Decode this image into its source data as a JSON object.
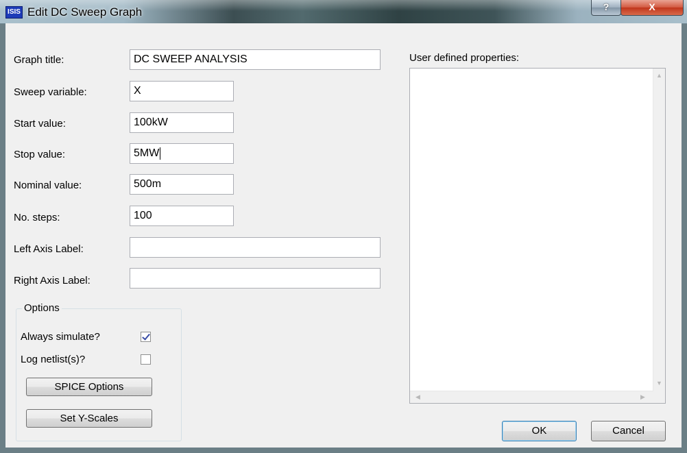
{
  "window": {
    "title": "Edit DC Sweep Graph",
    "app_icon_text": "ISIS",
    "help_glyph": "?",
    "close_glyph": "X"
  },
  "form": {
    "graph_title": {
      "label": "Graph title:",
      "value": "DC SWEEP ANALYSIS"
    },
    "sweep_variable": {
      "label": "Sweep variable:",
      "value": "X"
    },
    "start_value": {
      "label": "Start value:",
      "value": "100kW"
    },
    "stop_value": {
      "label": "Stop value:",
      "value": "5MW"
    },
    "nominal_value": {
      "label": "Nominal value:",
      "value": "500m"
    },
    "no_steps": {
      "label": "No. steps:",
      "value": "100"
    },
    "left_axis_label": {
      "label": "Left Axis Label:",
      "value": ""
    },
    "right_axis_label": {
      "label": "Right Axis Label:",
      "value": ""
    }
  },
  "options": {
    "title": "Options",
    "always_simulate": {
      "label": "Always simulate?",
      "checked": true
    },
    "log_netlists": {
      "label": "Log netlist(s)?",
      "checked": false
    },
    "spice_options_label": "SPICE Options",
    "set_y_scales_label": "Set Y-Scales"
  },
  "user_props": {
    "label": "User defined properties:",
    "text": ""
  },
  "buttons": {
    "ok": "OK",
    "cancel": "Cancel"
  },
  "icons": {
    "up": "scroll-up-arrow-icon",
    "down": "scroll-down-arrow-icon",
    "left": "scroll-left-arrow-icon",
    "right": "scroll-right-arrow-icon"
  }
}
